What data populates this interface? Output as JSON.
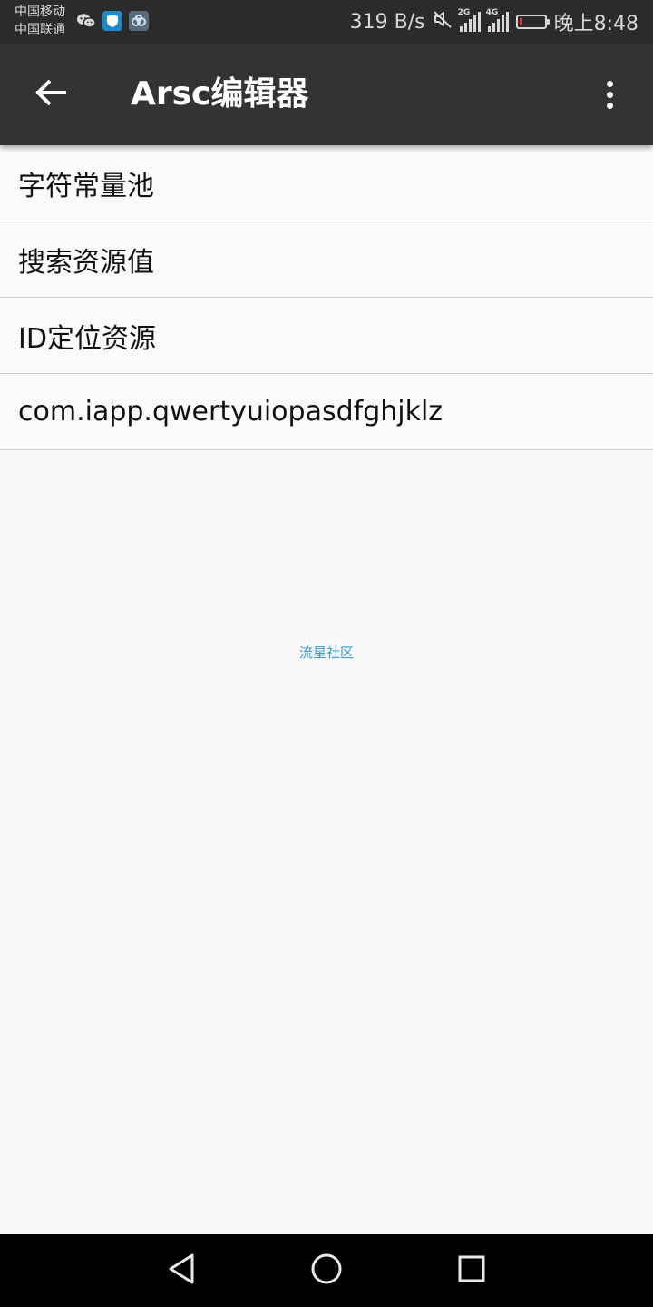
{
  "status_bar": {
    "carrier_1": "中国移动",
    "carrier_2": "中国联通",
    "network_speed": "319 B/s",
    "signal_1_tag": "2G",
    "signal_2_tag": "4G",
    "time": "晚上8:48",
    "battery_level_percent": 10,
    "colors": {
      "battery_low": "#e53935",
      "shield_app": "#1e88c8"
    }
  },
  "app_bar": {
    "title": "Arsc编辑器",
    "background": "#333333"
  },
  "menu": {
    "items": [
      {
        "label": "字符常量池"
      },
      {
        "label": "搜索资源值"
      },
      {
        "label": "ID定位资源"
      },
      {
        "label": "com.iapp.qwertyuiopasdfghjklz"
      }
    ]
  },
  "watermark": {
    "text": "流星社区",
    "color": "#3d9ad6"
  },
  "icons": {
    "back": "arrow-left-icon",
    "overflow": "more-vert-icon",
    "nav_back": "triangle-back-icon",
    "nav_home": "circle-home-icon",
    "nav_recents": "square-recents-icon"
  }
}
